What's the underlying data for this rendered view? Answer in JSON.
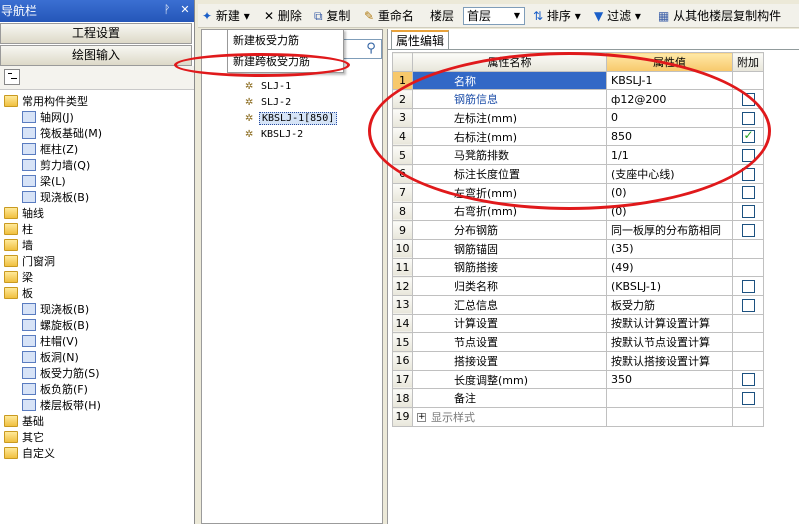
{
  "nav": {
    "title": "导航栏",
    "pin": "ᚹ",
    "close": "✕",
    "buttons": [
      "工程设置",
      "绘图输入"
    ],
    "tree": [
      {
        "level": 0,
        "icon": "folder",
        "label": "常用构件类型",
        "expanded": true
      },
      {
        "level": 1,
        "icon": "grid-icon",
        "label": "轴网(J)"
      },
      {
        "level": 1,
        "icon": "raft-icon",
        "label": "筏板基础(M)"
      },
      {
        "level": 1,
        "icon": "frame-column-icon",
        "label": "框柱(Z)"
      },
      {
        "level": 1,
        "icon": "shear-wall-icon",
        "label": "剪力墙(Q)"
      },
      {
        "level": 1,
        "icon": "beam-icon",
        "label": "梁(L)"
      },
      {
        "level": 1,
        "icon": "cast-slab-icon",
        "label": "现浇板(B)"
      },
      {
        "level": 0,
        "icon": "folder",
        "label": "轴线"
      },
      {
        "level": 0,
        "icon": "folder",
        "label": "柱"
      },
      {
        "level": 0,
        "icon": "folder",
        "label": "墙"
      },
      {
        "level": 0,
        "icon": "folder",
        "label": "门窗洞"
      },
      {
        "level": 0,
        "icon": "folder",
        "label": "梁"
      },
      {
        "level": 0,
        "icon": "folder",
        "label": "板",
        "expanded": true
      },
      {
        "level": 1,
        "icon": "cast-slab-icon",
        "label": "现浇板(B)"
      },
      {
        "level": 1,
        "icon": "spiral-slab-icon",
        "label": "螺旋板(B)"
      },
      {
        "level": 1,
        "icon": "column-cap-icon",
        "label": "柱帽(V)"
      },
      {
        "level": 1,
        "icon": "slab-hole-icon",
        "label": "板洞(N)"
      },
      {
        "level": 1,
        "icon": "slab-rebar-icon",
        "label": "板受力筋(S)",
        "selected": true
      },
      {
        "level": 1,
        "icon": "negative-rebar-icon",
        "label": "板负筋(F)"
      },
      {
        "level": 1,
        "icon": "floor-strip-icon",
        "label": "楼层板带(H)"
      },
      {
        "level": 0,
        "icon": "folder",
        "label": "基础"
      },
      {
        "level": 0,
        "icon": "folder",
        "label": "其它"
      },
      {
        "level": 0,
        "icon": "folder",
        "label": "自定义"
      }
    ]
  },
  "toolbar": {
    "new_label": "新建",
    "delete_label": "删除",
    "copy_label": "复制",
    "rename_label": "重命名",
    "floor_label": "楼层",
    "floor_value": "首层",
    "sort_label": "排序",
    "filter_label": "过滤",
    "copy_from_floor_label": "从其他楼层复制构件"
  },
  "dropdown": {
    "items": [
      "新建板受力筋",
      "新建跨板受力筋"
    ]
  },
  "component_list": {
    "items": [
      {
        "label": "SLJ-1"
      },
      {
        "label": "SLJ-2"
      },
      {
        "label": "KBSLJ-1[850]",
        "selected": true
      },
      {
        "label": "KBSLJ-2"
      }
    ]
  },
  "properties": {
    "tab": "属性编辑",
    "headers": {
      "name": "属性名称",
      "value": "属性值",
      "extra": "附加"
    },
    "rows": [
      {
        "num": "1",
        "name": "名称",
        "value": "KBSLJ-1",
        "checkbox": null,
        "selected": true
      },
      {
        "num": "2",
        "name": "钢筋信息",
        "value": "ф12@200",
        "checkbox": "unchecked",
        "blue": true
      },
      {
        "num": "3",
        "name": "左标注(mm)",
        "value": "0",
        "checkbox": "unchecked"
      },
      {
        "num": "4",
        "name": "右标注(mm)",
        "value": "850",
        "checkbox": "checked"
      },
      {
        "num": "5",
        "name": "马凳筋排数",
        "value": "1/1",
        "checkbox": "unchecked"
      },
      {
        "num": "6",
        "name": "标注长度位置",
        "value": "(支座中心线)",
        "checkbox": "unchecked"
      },
      {
        "num": "7",
        "name": "左弯折(mm)",
        "value": "(0)",
        "checkbox": "unchecked"
      },
      {
        "num": "8",
        "name": "右弯折(mm)",
        "value": "(0)",
        "checkbox": "unchecked"
      },
      {
        "num": "9",
        "name": "分布钢筋",
        "value": "同一板厚的分布筋相同",
        "checkbox": "unchecked"
      },
      {
        "num": "10",
        "name": "钢筋锚固",
        "value": "(35)",
        "checkbox": null
      },
      {
        "num": "11",
        "name": "钢筋搭接",
        "value": "(49)",
        "checkbox": null
      },
      {
        "num": "12",
        "name": "归类名称",
        "value": "(KBSLJ-1)",
        "checkbox": "unchecked"
      },
      {
        "num": "13",
        "name": "汇总信息",
        "value": "板受力筋",
        "checkbox": "unchecked"
      },
      {
        "num": "14",
        "name": "计算设置",
        "value": "按默认计算设置计算",
        "checkbox": null
      },
      {
        "num": "15",
        "name": "节点设置",
        "value": "按默认节点设置计算",
        "checkbox": null
      },
      {
        "num": "16",
        "name": "搭接设置",
        "value": "按默认搭接设置计算",
        "checkbox": null
      },
      {
        "num": "17",
        "name": "长度调整(mm)",
        "value": "350",
        "checkbox": "unchecked"
      },
      {
        "num": "18",
        "name": "备注",
        "value": "",
        "checkbox": "unchecked"
      },
      {
        "num": "19",
        "name": "显示样式",
        "value": "",
        "checkbox": null,
        "expander": "+"
      }
    ]
  },
  "annotation_color": "#e0191b"
}
